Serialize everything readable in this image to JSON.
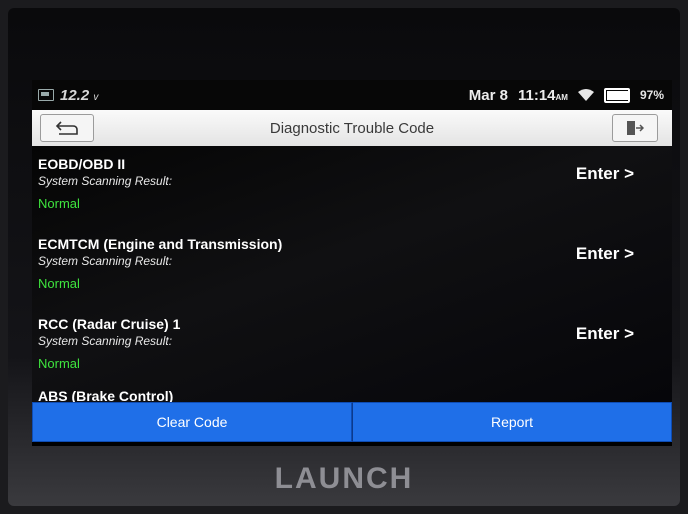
{
  "status_bar": {
    "voltage": "12.2",
    "voltage_unit": "v",
    "date": "Mar 8",
    "time": "11:14",
    "ampm": "AM",
    "battery": "97%"
  },
  "header": {
    "title": "Diagnostic Trouble Code"
  },
  "systems": [
    {
      "name": "EOBD/OBD II",
      "scan_label": "System Scanning Result:",
      "result": "Normal",
      "action": "Enter >"
    },
    {
      "name": "ECMTCM (Engine and Transmission)",
      "scan_label": "System Scanning Result:",
      "result": "Normal",
      "action": "Enter >"
    },
    {
      "name": "RCC (Radar Cruise) 1",
      "scan_label": "System Scanning Result:",
      "result": "Normal",
      "action": "Enter >"
    }
  ],
  "partial_item": "ABS (Brake Control)",
  "buttons": {
    "clear_code": "Clear Code",
    "report": "Report"
  },
  "brand": "LAUNCH",
  "icons": [
    "vci-icon",
    "wifi-icon",
    "battery-icon",
    "back-icon",
    "exit-icon"
  ],
  "colors": {
    "accent": "#1f6fe8",
    "normal": "#3ee43e"
  }
}
